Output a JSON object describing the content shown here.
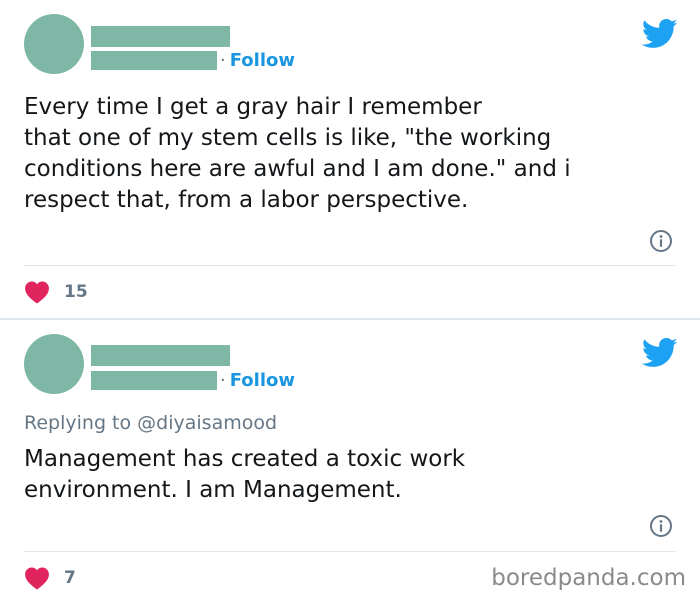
{
  "tweets": [
    {
      "follow_separator": "·",
      "follow_label": "Follow",
      "reply_prefix": "",
      "reply_handle": "",
      "text": "Every time I get a gray hair I remember\nthat one of my stem cells is like, \"the working\nconditions here are awful and I am done.\" and i\nrespect that, from a labor perspective.",
      "likes": "15"
    },
    {
      "follow_separator": "·",
      "follow_label": "Follow",
      "reply_prefix": "Replying to",
      "reply_handle": "@diyaisamood",
      "text": "Management has created a toxic work\nenvironment. I am Management.",
      "likes": "7"
    }
  ],
  "watermark": "boredpanda.com",
  "colors": {
    "avatar_placeholder": "#7fb7a6",
    "follow_link": "#1b95e0",
    "twitter_bird": "#1da1f2",
    "heart": "#e0245e",
    "muted_text": "#657786",
    "divider": "#e1e8ed"
  },
  "icons": {
    "brand": "twitter-bird-icon",
    "info": "info-icon",
    "like": "heart-icon"
  }
}
